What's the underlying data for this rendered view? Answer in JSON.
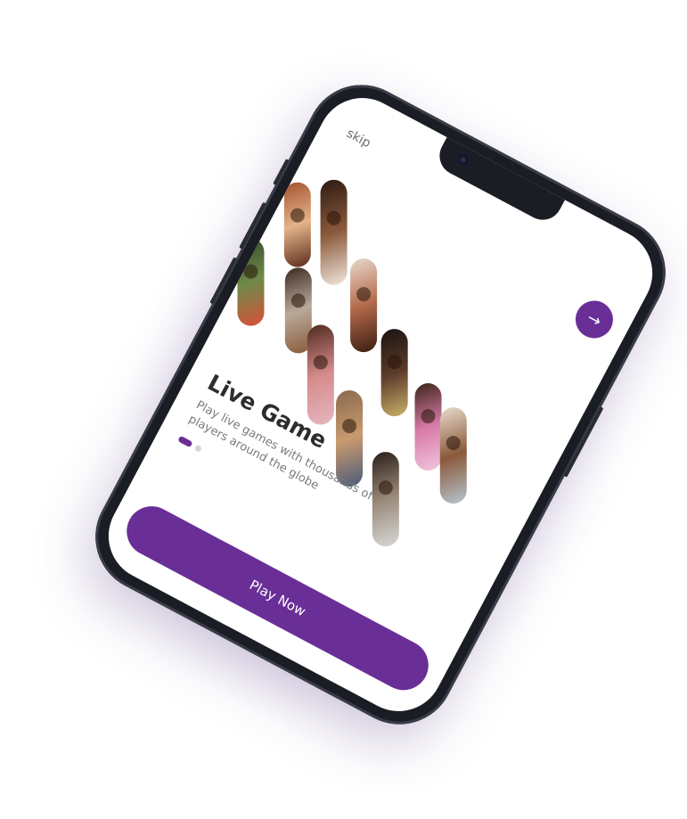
{
  "onboarding": {
    "skip_label": "skip",
    "next_icon": "arrow-right-icon",
    "title": "Live Game",
    "subtitle": "Play live games with thousands of players around the globe",
    "pagination": {
      "total": 2,
      "active": 1
    },
    "cta_label": "Play Now"
  },
  "colors": {
    "accent": "#6a2f97",
    "phone_frame": "#1b1d24",
    "title_text": "#2d2d2d",
    "subtitle_text": "#7a7a7a",
    "inactive_dot": "#d6d6d6"
  }
}
